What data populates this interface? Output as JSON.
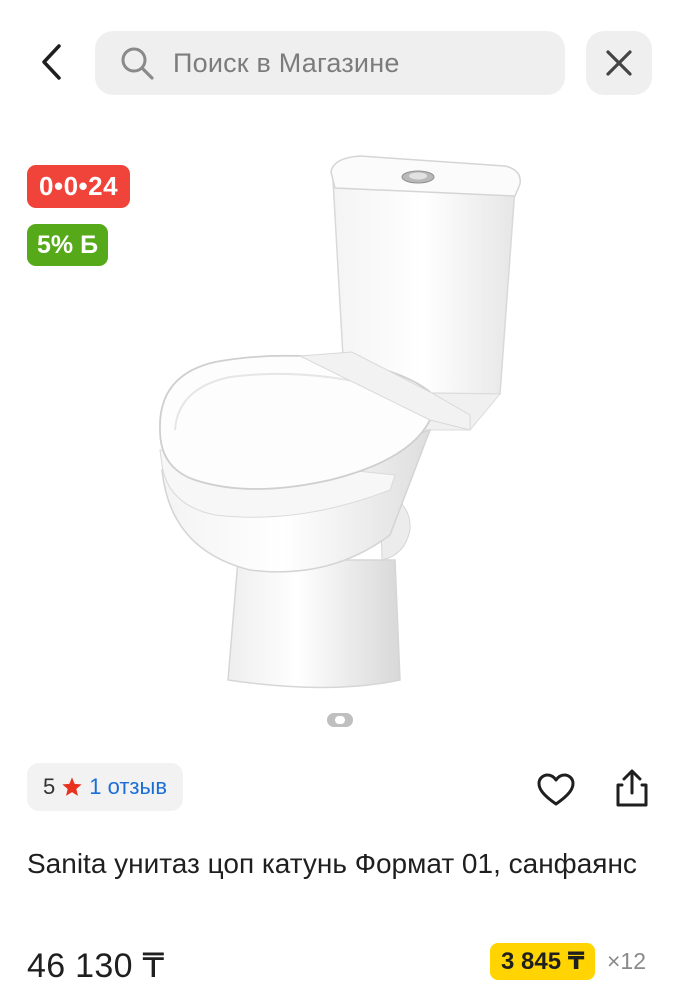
{
  "search": {
    "placeholder": "Поиск в Магазине"
  },
  "badges": {
    "timer": "0•0•24",
    "bonus": "5% Б"
  },
  "rating": {
    "score": "5",
    "reviews": "1 отзыв"
  },
  "product": {
    "title": "Sanita унитаз цоп катунь Формат 01, санфаянс"
  },
  "pricing": {
    "price": "46 130 ₸",
    "installment_price": "3 845 ₸",
    "installment_months": "×12"
  },
  "colors": {
    "timer_badge": "#f0443a",
    "bonus_badge": "#56a918",
    "installment_badge": "#ffd400",
    "review_link": "#1a6ed6",
    "star": "#e8321f"
  },
  "icons": [
    "back-arrow-icon",
    "search-icon",
    "close-icon",
    "star-icon",
    "heart-icon",
    "share-icon"
  ],
  "gallery": {
    "image": "white ceramic toilet with cistern",
    "pages": 1,
    "current_page": 1
  }
}
